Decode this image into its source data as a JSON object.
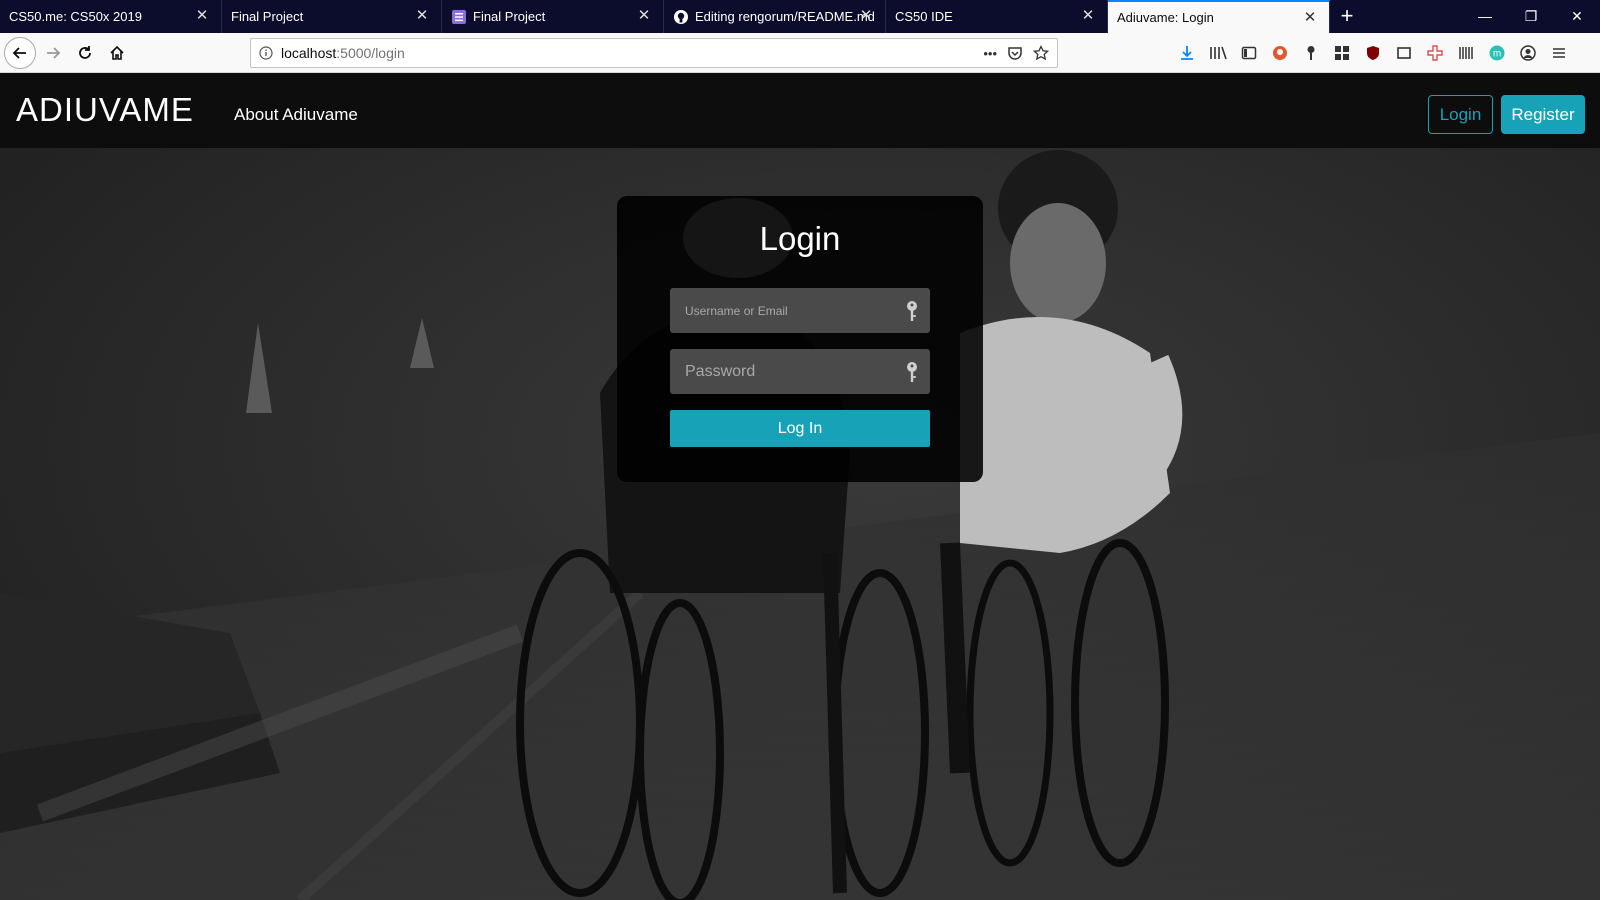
{
  "browser": {
    "tabs": [
      {
        "title": "CS50.me: CS50x 2019",
        "favicon": "none"
      },
      {
        "title": "Final Project",
        "favicon": "none"
      },
      {
        "title": "Final Project",
        "favicon": "list-icon"
      },
      {
        "title": "Editing rengorum/README.md",
        "favicon": "github-icon"
      },
      {
        "title": "CS50 IDE",
        "favicon": "none"
      },
      {
        "title": "Adiuvame: Login",
        "favicon": "none",
        "active": true
      }
    ],
    "new_tab_label": "+",
    "url": {
      "host": "localhost",
      "path": ":5000/login"
    },
    "page_actions": "•••"
  },
  "site": {
    "brand": "ADIUVAME",
    "nav_about": "About Adiuvame",
    "login_button": "Login",
    "register_button": "Register"
  },
  "login_form": {
    "title": "Login",
    "username_placeholder": "Username or Email",
    "password_placeholder": "Password",
    "submit_label": "Log In"
  },
  "colors": {
    "accent": "#17a2b8",
    "tabstrip": "#0c0c2c",
    "header": "#0d0d0d"
  }
}
